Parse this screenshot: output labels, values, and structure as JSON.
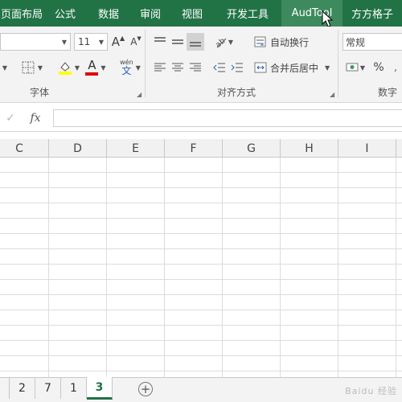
{
  "ribbon_tabs": [
    "页面布局",
    "公式",
    "数据",
    "审阅",
    "视图",
    "开发工具",
    "AudTool",
    "方方格子"
  ],
  "active_tab_index": 6,
  "font_group": {
    "label": "字体",
    "font_size": "11",
    "grow_font": "A",
    "shrink_font": "A",
    "font_color_letter": "A",
    "phonetic_top": "wén",
    "phonetic_bottom": "文"
  },
  "alignment_group": {
    "label": "对齐方式",
    "wrap_text": "自动换行",
    "merge_center": "合并后居中"
  },
  "number_group": {
    "label": "数字",
    "format": "常规",
    "percent": "%"
  },
  "formula_bar": {
    "fx_label": "fx",
    "value": ""
  },
  "columns": [
    "C",
    "D",
    "E",
    "F",
    "G",
    "H",
    "I"
  ],
  "sheets": [
    "2",
    "7",
    "1",
    "3"
  ],
  "active_sheet_index": 3,
  "add_sheet_symbol": "+",
  "watermark": "Baidu 经验",
  "colors": {
    "ribbon_green": "#217346",
    "active_tab": "#3d8a5e",
    "highlight_yellow": "#ffff00",
    "font_red": "#e00000"
  }
}
